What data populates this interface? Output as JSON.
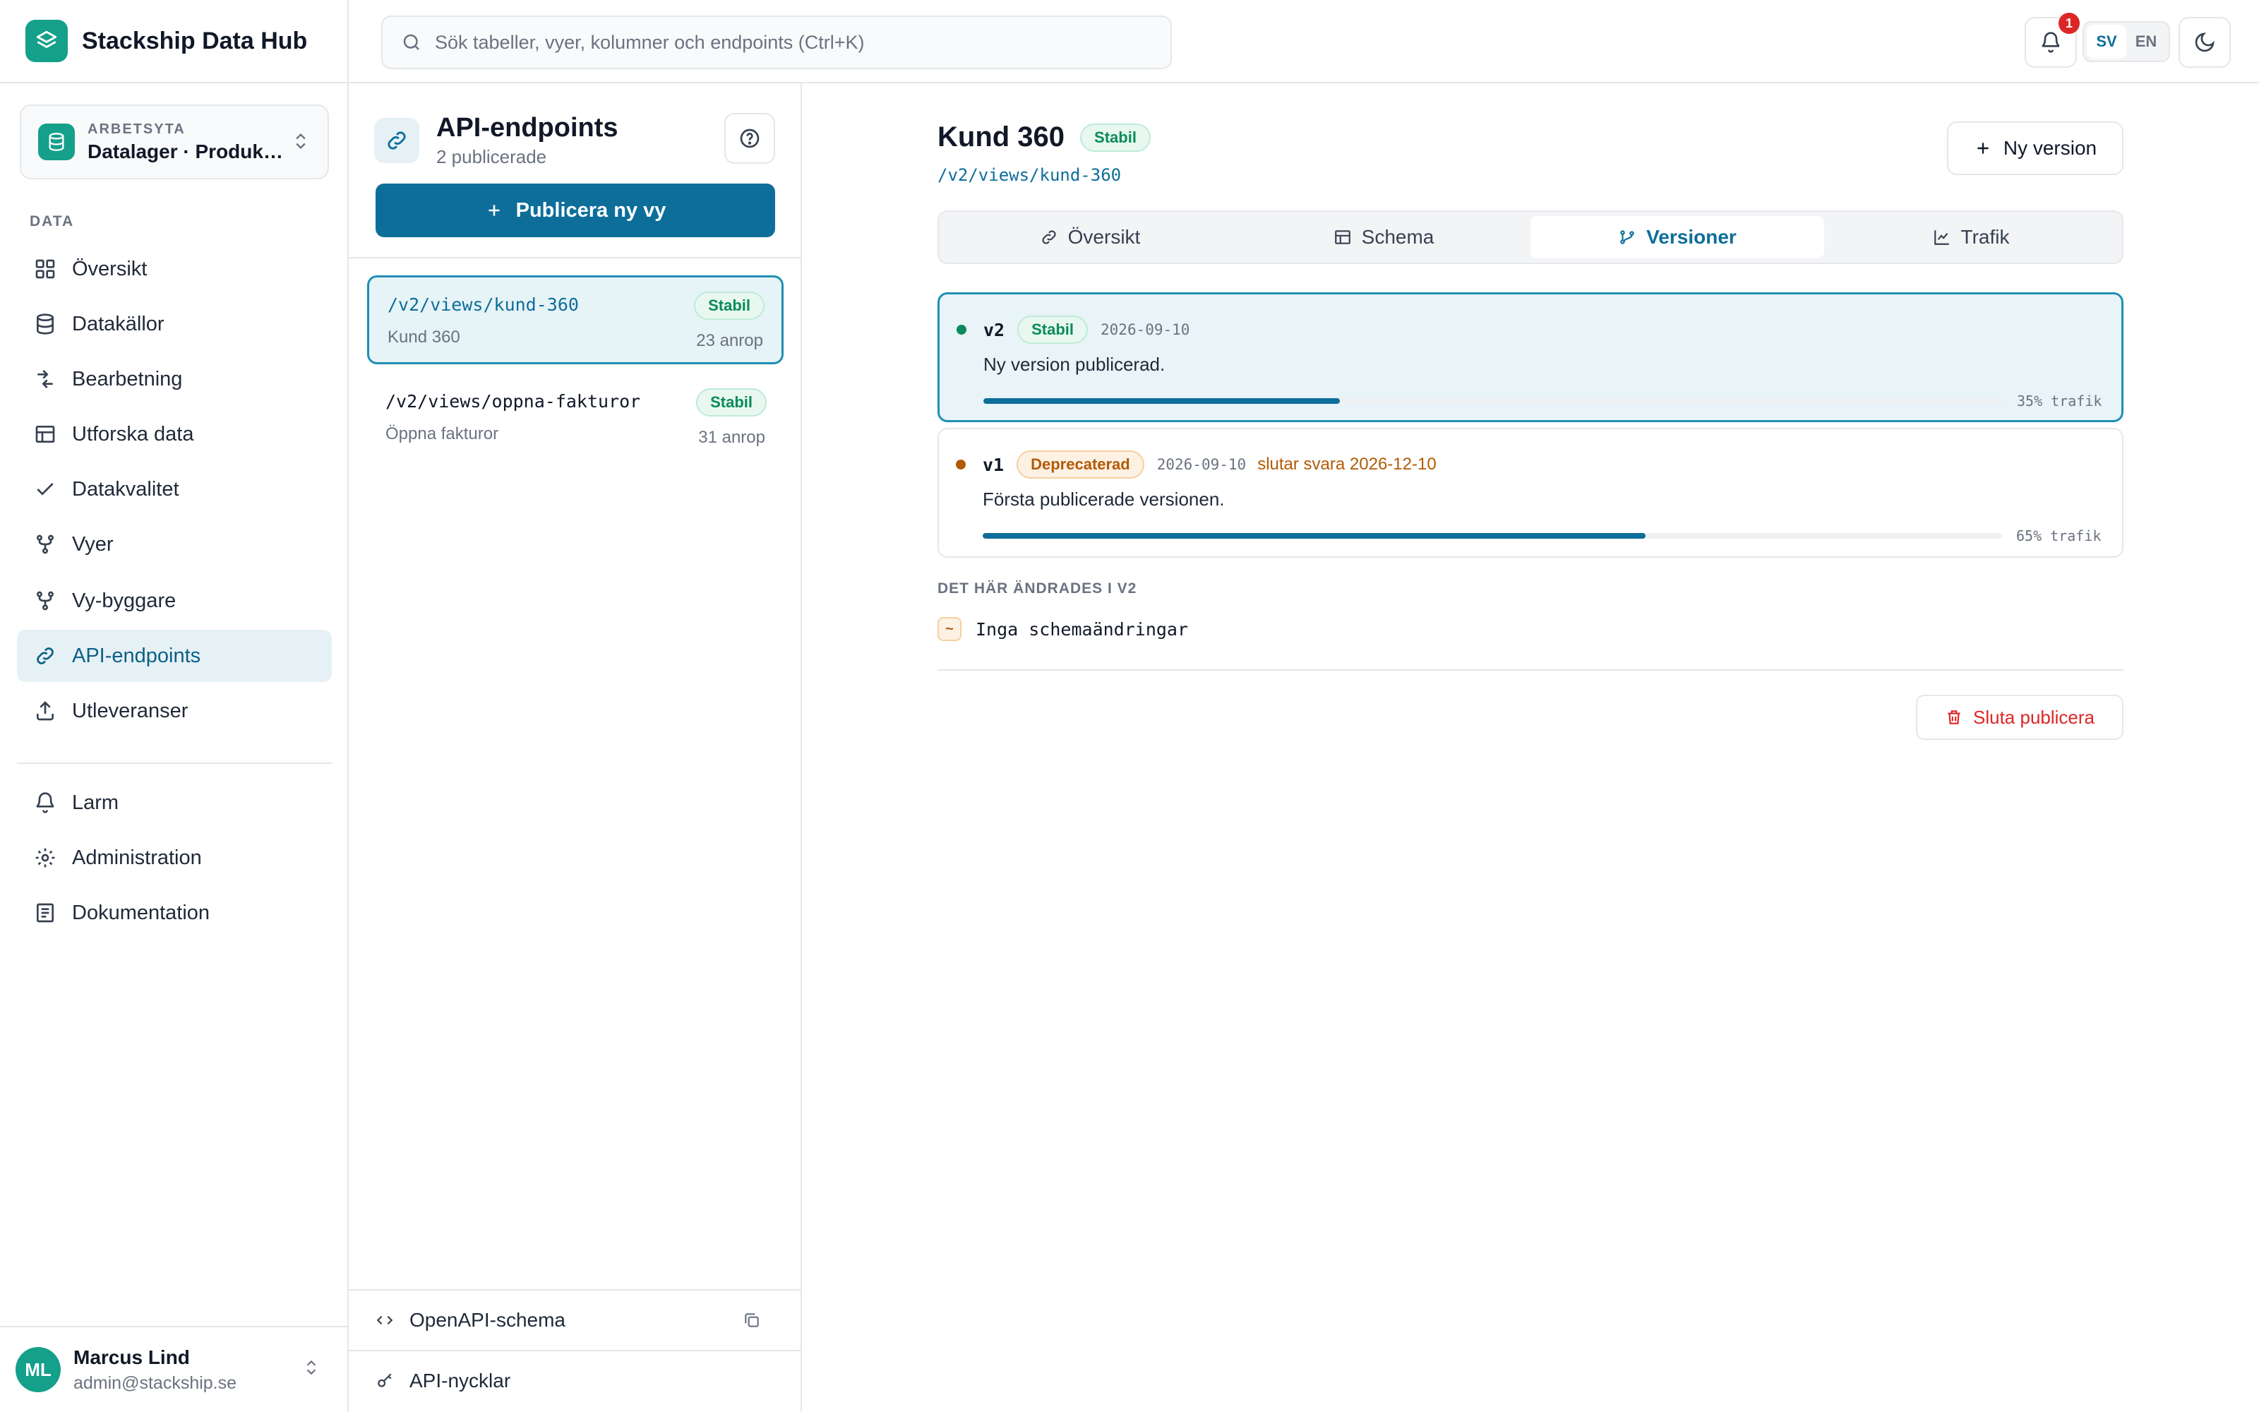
{
  "app": {
    "name": "Stackship Data Hub"
  },
  "workspace": {
    "kicker": "ARBETSYTA",
    "name": "Datalager · Produktion"
  },
  "sidebar": {
    "section_label": "DATA",
    "items": [
      {
        "label": "Översikt",
        "icon": "grid-icon"
      },
      {
        "label": "Datakällor",
        "icon": "database-icon"
      },
      {
        "label": "Bearbetning",
        "icon": "arrows-icon"
      },
      {
        "label": "Utforska data",
        "icon": "table-icon"
      },
      {
        "label": "Datakvalitet",
        "icon": "check-icon"
      },
      {
        "label": "Vyer",
        "icon": "branch-icon"
      },
      {
        "label": "Vy-byggare",
        "icon": "branch-icon"
      },
      {
        "label": "API-endpoints",
        "icon": "link-icon"
      },
      {
        "label": "Utleveranser",
        "icon": "upload-icon"
      },
      {
        "label": "Larm",
        "icon": "bell-icon"
      },
      {
        "label": "Administration",
        "icon": "gear-icon"
      },
      {
        "label": "Dokumentation",
        "icon": "book-icon"
      }
    ]
  },
  "user": {
    "initials": "ML",
    "name": "Marcus Lind",
    "email": "admin@stackship.se"
  },
  "topbar": {
    "search_placeholder": "Sök tabeller, vyer, kolumner och endpoints (Ctrl+K)",
    "notification_count": "1",
    "languages": [
      "SV",
      "EN"
    ],
    "active_language": "SV"
  },
  "list_panel": {
    "title": "API-endpoints",
    "subtitle": "2 publicerade",
    "publish_button": "Publicera ny vy",
    "endpoints": [
      {
        "path": "/v2/views/kund-360",
        "name": "Kund 360",
        "status": "Stabil",
        "calls": "23 anrop"
      },
      {
        "path": "/v2/views/oppna-fakturor",
        "name": "Öppna fakturor",
        "status": "Stabil",
        "calls": "31 anrop"
      }
    ],
    "footer": {
      "openapi": "OpenAPI-schema",
      "keys": "API-nycklar"
    }
  },
  "detail": {
    "title": "Kund 360",
    "status": "Stabil",
    "path": "/v2/views/kund-360",
    "new_version_button": "Ny version",
    "tabs": [
      "Översikt",
      "Schema",
      "Versioner",
      "Trafik"
    ],
    "active_tab": "Versioner",
    "versions": [
      {
        "label": "v2",
        "status": "Stabil",
        "date": "2026-09-10",
        "sunset": "",
        "message": "Ny version publicerad.",
        "traffic_percent": 35,
        "traffic_label": "35% trafik"
      },
      {
        "label": "v1",
        "status": "Deprecaterad",
        "date": "2026-09-10",
        "sunset": "slutar svara 2026-12-10",
        "message": "Första publicerade versionen.",
        "traffic_percent": 65,
        "traffic_label": "65% trafik"
      }
    ],
    "changes_label": "DET HÄR ÄNDRADES I V2",
    "change_mark": "~",
    "change_text": "Inga schemaändringar",
    "unpublish_button": "Sluta publicera"
  },
  "colors": {
    "accent": "#0d6e99",
    "brand": "#14a08a",
    "stable": "#0a8a5a",
    "deprecated": "#b35a05",
    "danger": "#dc2626"
  }
}
